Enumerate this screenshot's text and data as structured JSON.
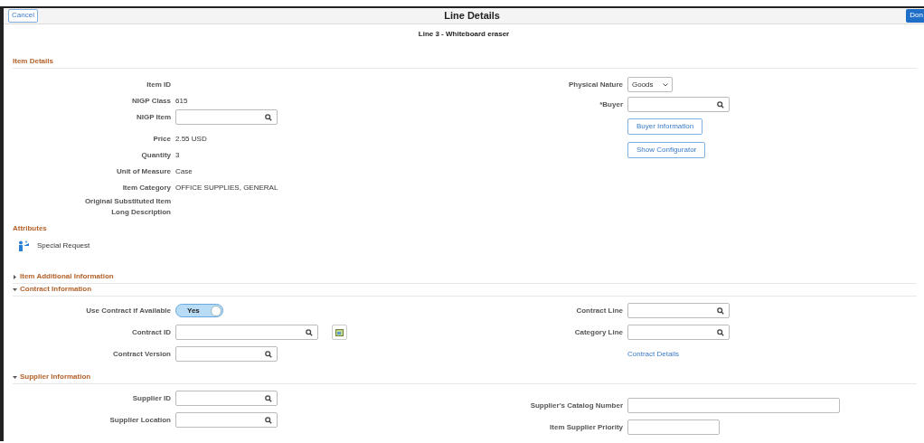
{
  "header": {
    "cancel": "Cancel",
    "title": "Line Details",
    "done": "Don"
  },
  "subtitle": "Line 3 - Whiteboard eraser",
  "sections": [
    {
      "title": "Item Details",
      "left": [
        {
          "kind": "text",
          "label": "Item ID"
        },
        {
          "kind": "text",
          "label": "NIGP Class",
          "value": "615"
        },
        {
          "kind": "lookup",
          "label": "NIGP Item"
        },
        {
          "kind": "text",
          "label": "Price",
          "value": "2.55 USD"
        },
        {
          "kind": "text",
          "label": "Quantity",
          "value": "3"
        },
        {
          "kind": "text",
          "label": "Unit of Measure",
          "value": "Case"
        },
        {
          "kind": "text",
          "label": "Item Category",
          "value": "OFFICE SUPPLIES, GENERAL"
        },
        {
          "kind": "text",
          "label": "Original Substituted Item Long Description"
        }
      ],
      "right": [
        {
          "kind": "select",
          "label": "Physical Nature",
          "value": "Goods"
        },
        {
          "kind": "lookup",
          "label": "*Buyer"
        },
        {
          "kind": "button",
          "label": "Buyer Information"
        },
        {
          "kind": "button",
          "label": "Show Configurator"
        }
      ],
      "attributes": {
        "title": "Attributes",
        "items": [
          "Special Request"
        ]
      }
    },
    {
      "title": "Item Additional Information",
      "expanded": false
    },
    {
      "title": "Contract Information",
      "expanded": true,
      "left": [
        {
          "kind": "toggle",
          "label": "Use Contract if Available",
          "on": true,
          "value": "Yes"
        },
        {
          "kind": "contract_lookup",
          "label": "Contract ID"
        },
        {
          "kind": "lookup",
          "label": "Contract Version"
        }
      ],
      "right": [
        {
          "kind": "lookup",
          "label": "Contract Line"
        },
        {
          "kind": "lookup",
          "label": "Category Line"
        },
        {
          "kind": "link",
          "label": "Contract Details"
        }
      ]
    },
    {
      "title": "Supplier Information",
      "expanded": true,
      "left": [
        {
          "kind": "lookup",
          "label": "Supplier ID"
        },
        {
          "kind": "lookup",
          "label": "Supplier Location"
        }
      ],
      "right": [
        {
          "kind": "input_wide",
          "label": "Supplier's Catalog Number"
        },
        {
          "kind": "input",
          "label": "Item Supplier Priority"
        }
      ]
    }
  ]
}
